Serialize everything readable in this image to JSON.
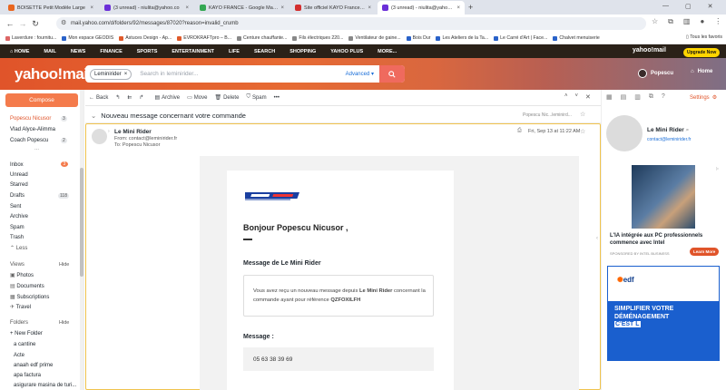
{
  "browser": {
    "tabs": [
      {
        "title": "BOISETTE Petit Modèle Large",
        "color": "#e9661f"
      },
      {
        "title": "(3 unread) - niulita@yahoo.co",
        "color": "#6b2fd8"
      },
      {
        "title": "KAYO FRANCE - Google Maps",
        "color": "#34a853"
      },
      {
        "title": "Site officiel KAYO France - Quad",
        "color": "#d32f2f"
      },
      {
        "title": "(3 unread) - niulita@yahoo.co",
        "color": "#6b2fd8"
      }
    ],
    "url": "mail.yahoo.com/d/folders/92/messages/87020?reason=invalid_crumb",
    "bookmarks": [
      "Laverdure : fournitu...",
      "Mon espace GEODIS",
      "Astuces Design - Ap...",
      "EVROKRAFTpro – B...",
      "Centure chauffante...",
      "Fils électriques 220...",
      "Ventilateur de gaine...",
      "Bois Dur",
      "Les Ateliers de la Ta...",
      "Le Carré d'Art | Face...",
      "Chalvet menuiserie"
    ],
    "all_bookmarks": "Tous les favoris"
  },
  "ynav": {
    "items": [
      "HOME",
      "MAIL",
      "NEWS",
      "FINANCE",
      "SPORTS",
      "ENTERTAINMENT",
      "LIFE",
      "SEARCH",
      "SHOPPING",
      "YAHOO PLUS",
      "MORE..."
    ],
    "logo_small": "yahoo!mail",
    "upgrade": "Upgrade Now"
  },
  "header": {
    "logo": "yahoo!mail",
    "search_chip": "Leminirider",
    "search_placeholder": "Search in leminirider...",
    "advanced": "Advanced",
    "user_name": "Popescu",
    "home": "Home"
  },
  "sidebar": {
    "compose": "Compose",
    "contacts": [
      {
        "name": "Popescu Nicusor",
        "count": "3"
      },
      {
        "name": "Vlad Alyce-Alimma",
        "count": ""
      },
      {
        "name": "Coach Popescu",
        "count": "2"
      }
    ],
    "more": "...",
    "folders": [
      {
        "name": "Inbox",
        "count": "3"
      },
      {
        "name": "Unread",
        "count": ""
      },
      {
        "name": "Starred",
        "count": ""
      },
      {
        "name": "Drafts",
        "count": "118"
      },
      {
        "name": "Sent",
        "count": ""
      },
      {
        "name": "Archive",
        "count": ""
      },
      {
        "name": "Spam",
        "count": ""
      },
      {
        "name": "Trash",
        "count": ""
      }
    ],
    "less": "Less",
    "views_header": "Views",
    "hide": "Hide",
    "views": [
      "Photos",
      "Documents",
      "Subscriptions",
      "Travel"
    ],
    "folders_header": "Folders",
    "new_folder": "New Folder",
    "custom_folders": [
      "a cantine",
      "Acte",
      "anaah edf prime",
      "apa factura",
      "asigurare masina de turi..."
    ]
  },
  "toolbar": {
    "back": "Back",
    "archive": "Archive",
    "move": "Move",
    "delete": "Delete",
    "spam": "Spam",
    "more": "•••"
  },
  "message": {
    "subject": "Nouveau message concernant votre commande",
    "subject_preview": "Popescu Nic...leminird...",
    "sender": "Le Mini Rider",
    "from": "From: contact@leminirider.fr",
    "to": "To: Popescu Nicusor",
    "date": "Fri, Sep 13 at 11:22 AM",
    "greeting": "Bonjour Popescu Nicusor ,",
    "from_title": "Message de Le Mini Rider",
    "notice_pre": "Vous avez reçu un nouveau message depuis ",
    "notice_brand": "Le Mini Rider",
    "notice_mid": " concernant la commande ayant pour référence ",
    "notice_ref": "QZFOXILFH",
    "message_label": "Message :",
    "message_body": "05 63 38 39 69"
  },
  "right": {
    "settings": "Settings",
    "contact_name": "Le Mini Rider",
    "contact_email": "contact@leminirider.fr",
    "ad1_title": "L'IA intégrée aux PC professionnels commence avec Intel",
    "ad1_sponsor": "SPONSORED BY INTEL BUSINESS",
    "ad1_cta": "Learn More",
    "ad2_brand": "edf",
    "ad2_line1": "SIMPLIFIER VOTRE",
    "ad2_line2": "DÉMÉNAGEMENT",
    "ad2_line3": "C'EST L"
  }
}
